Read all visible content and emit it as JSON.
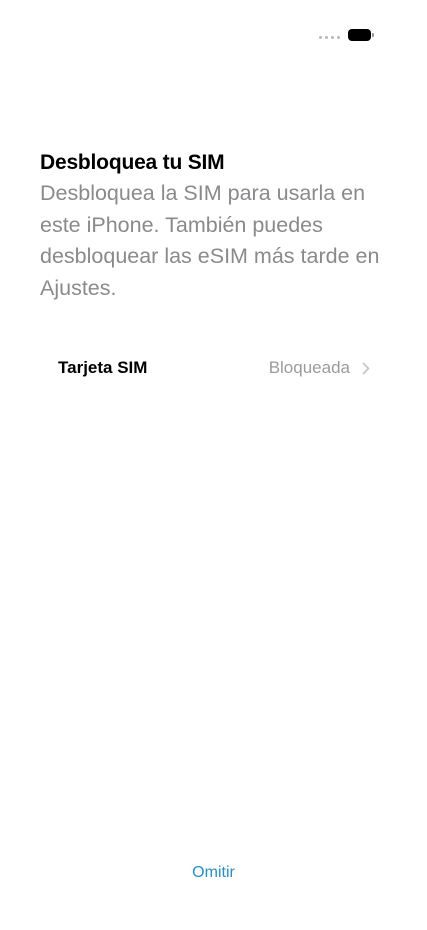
{
  "status_bar": {
    "signal_icon": "signal-dots-icon",
    "battery_icon": "battery-full-icon"
  },
  "header": {
    "title": "Desbloquea tu SIM",
    "description": "Desbloquea la SIM para usarla en este iPhone. También puedes desbloquear las eSIM más tarde en Ajustes."
  },
  "sim_list": {
    "items": [
      {
        "label": "Tarjeta SIM",
        "status": "Bloqueada",
        "icon": "chevron-right-icon"
      }
    ]
  },
  "footer": {
    "skip_label": "Omitir"
  },
  "colors": {
    "accent": "#1f8fd6",
    "secondary_text": "#8a8a8e",
    "primary_text": "#000000",
    "background": "#ffffff"
  }
}
